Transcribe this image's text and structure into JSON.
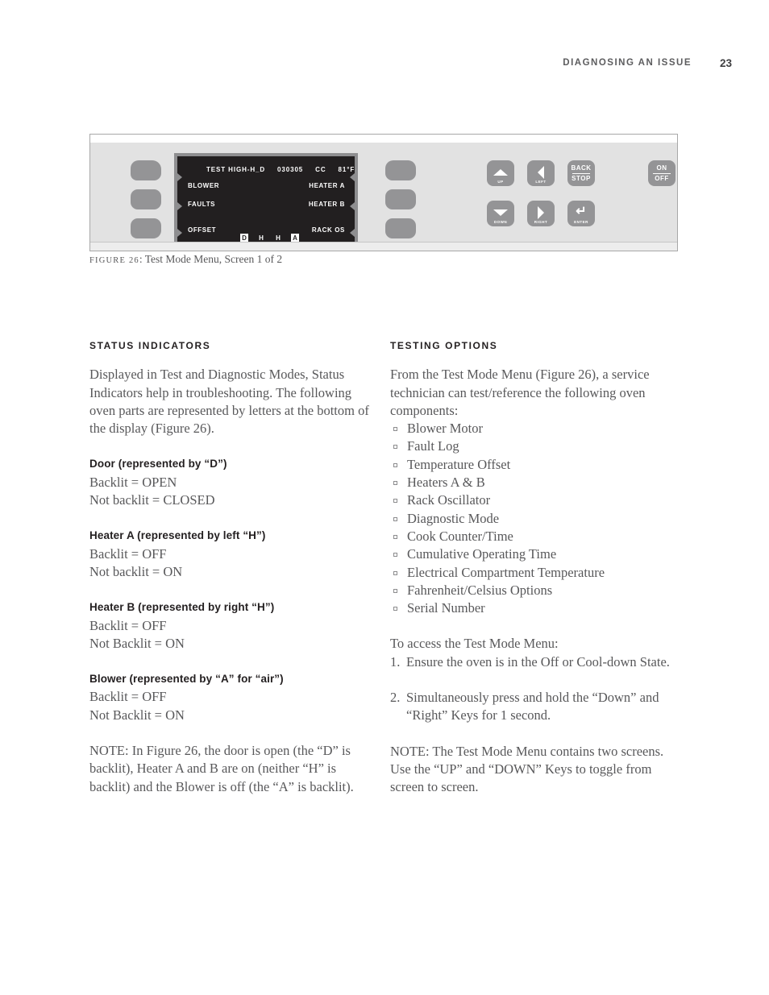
{
  "header": {
    "title": "DIAGNOSING AN ISSUE",
    "page_number": "23"
  },
  "figure": {
    "caption_prefix": "FIGURE 26",
    "caption_text": ": Test Mode Menu, Screen 1 of 2",
    "lcd": {
      "title_mode": "TEST HIGH-H_D",
      "title_code": "030305",
      "title_cc": "CC",
      "title_temp": "81°F",
      "left_items": [
        "BLOWER",
        "FAULTS",
        "OFFSET"
      ],
      "right_items": [
        "HEATER A",
        "HEATER B",
        "RACK OS"
      ],
      "status_indicators": [
        {
          "letter": "D",
          "backlit": true
        },
        {
          "letter": "H",
          "backlit": false
        },
        {
          "letter": "H",
          "backlit": false
        },
        {
          "letter": "A",
          "backlit": true
        }
      ]
    },
    "keys": {
      "up": "UP",
      "down": "DOWN",
      "left": "LEFT",
      "right": "RIGHT",
      "enter": "ENTER",
      "back": "BACK",
      "stop": "STOP",
      "on": "ON",
      "off": "OFF",
      "enter_glyph": "↵"
    },
    "colors": {
      "panel": "#e2e2e2",
      "key": "#949496",
      "lcd_screen": "#221f20",
      "lcd_bezel": "#8e8e90"
    }
  },
  "left_column": {
    "heading": "STATUS INDICATORS",
    "intro": "Displayed in Test and Diagnostic Modes, Status Indicators help in troubleshooting. The following oven parts are represented by letters at the bottom of the display (Figure 26).",
    "definitions": [
      {
        "term": "Door",
        "qualifier": " (represented by “D”)",
        "line1": "Backlit = OPEN",
        "line2": "Not backlit = CLOSED"
      },
      {
        "term": "Heater A",
        "qualifier": " (represented by left “H”)",
        "line1": "Backlit = OFF",
        "line2": "Not backlit = ON"
      },
      {
        "term": "Heater B",
        "qualifier": " (represented by right “H”)",
        "line1": "Backlit = OFF",
        "line2": "Not Backlit = ON"
      },
      {
        "term": "Blower",
        "qualifier": " (represented by “A” for “air”)",
        "line1": "Backlit = OFF",
        "line2": "Not Backlit = ON"
      }
    ],
    "note": "NOTE: In Figure 26, the door is open (the “D” is backlit), Heater A and B are on (neither “H” is backlit) and the Blower is off (the “A” is backlit)."
  },
  "right_column": {
    "heading": "TESTING OPTIONS",
    "intro": "From the Test Mode Menu (Figure 26), a service technician can test/reference the following oven components:",
    "options": [
      "Blower Motor",
      "Fault Log",
      "Temperature Offset",
      "Heaters A & B",
      "Rack Oscillator",
      "Diagnostic Mode",
      "Cook Counter/Time",
      "Cumulative Operating Time",
      "Electrical Compartment Temperature",
      "Fahrenheit/Celsius Options",
      "Serial Number"
    ],
    "access_intro": "To access the Test Mode Menu:",
    "steps": [
      {
        "num": "1.",
        "text": "Ensure the oven is in the Off or Cool-down State."
      },
      {
        "num": "2.",
        "text": "Simultaneously press and hold the “Down” and “Right” Keys for 1 second."
      }
    ],
    "note": "NOTE: The Test Mode Menu contains two screens. Use the “UP” and “DOWN” Keys to toggle from screen to screen."
  }
}
